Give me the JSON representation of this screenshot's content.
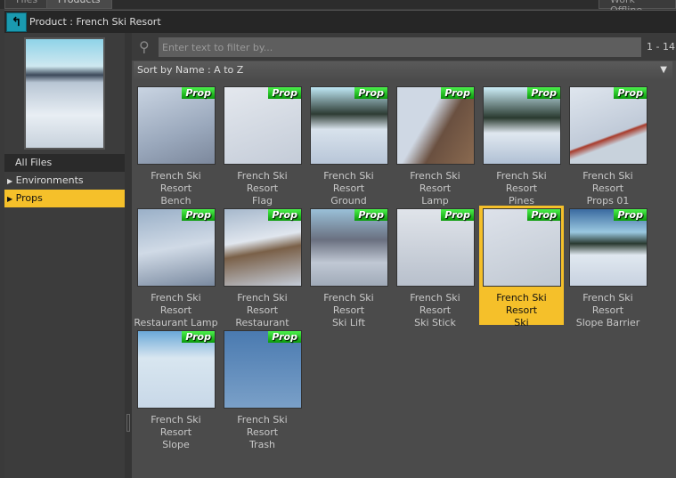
{
  "tabs": [
    {
      "label": "Files"
    },
    {
      "label": "Products"
    },
    {
      "label": "Work Offline"
    }
  ],
  "header": {
    "back_icon": "back-arrow-icon",
    "breadcrumb": "Product :  French Ski Resort"
  },
  "sidebar": {
    "items": [
      {
        "label": "All Files"
      },
      {
        "label": "Environments",
        "arrow": "▶"
      },
      {
        "label": "Props",
        "arrow": "▶",
        "selected": true
      }
    ]
  },
  "filter": {
    "placeholder": "Enter text to filter by...",
    "value": "",
    "count": "1 - 14"
  },
  "sort": {
    "label": "Sort by Name : A to Z"
  },
  "badge_label": "Prop",
  "colors": {
    "accent": "#f5c02a",
    "badge": "#1fc41f",
    "back_button": "#1a9ab0"
  },
  "items": [
    {
      "line1": "French Ski Resort",
      "line2": "Bench"
    },
    {
      "line1": "French Ski Resort",
      "line2": "Flag"
    },
    {
      "line1": "French Ski Resort",
      "line2": "Ground"
    },
    {
      "line1": "French Ski Resort",
      "line2": "Lamp"
    },
    {
      "line1": "French Ski Resort",
      "line2": "Pines"
    },
    {
      "line1": "French Ski Resort",
      "line2": "Props 01"
    },
    {
      "line1": "French Ski Resort",
      "line2": "Restaurant Lamp"
    },
    {
      "line1": "French Ski Resort",
      "line2": "Restaurant Tables"
    },
    {
      "line1": "French Ski Resort",
      "line2": "Ski Lift"
    },
    {
      "line1": "French Ski Resort",
      "line2": "Ski Stick"
    },
    {
      "line1": "French Ski Resort",
      "line2": "Ski",
      "selected": true
    },
    {
      "line1": "French Ski Resort",
      "line2": "Slope Barrier"
    },
    {
      "line1": "French Ski Resort",
      "line2": "Slope"
    },
    {
      "line1": "French Ski Resort",
      "line2": "Trash"
    }
  ]
}
